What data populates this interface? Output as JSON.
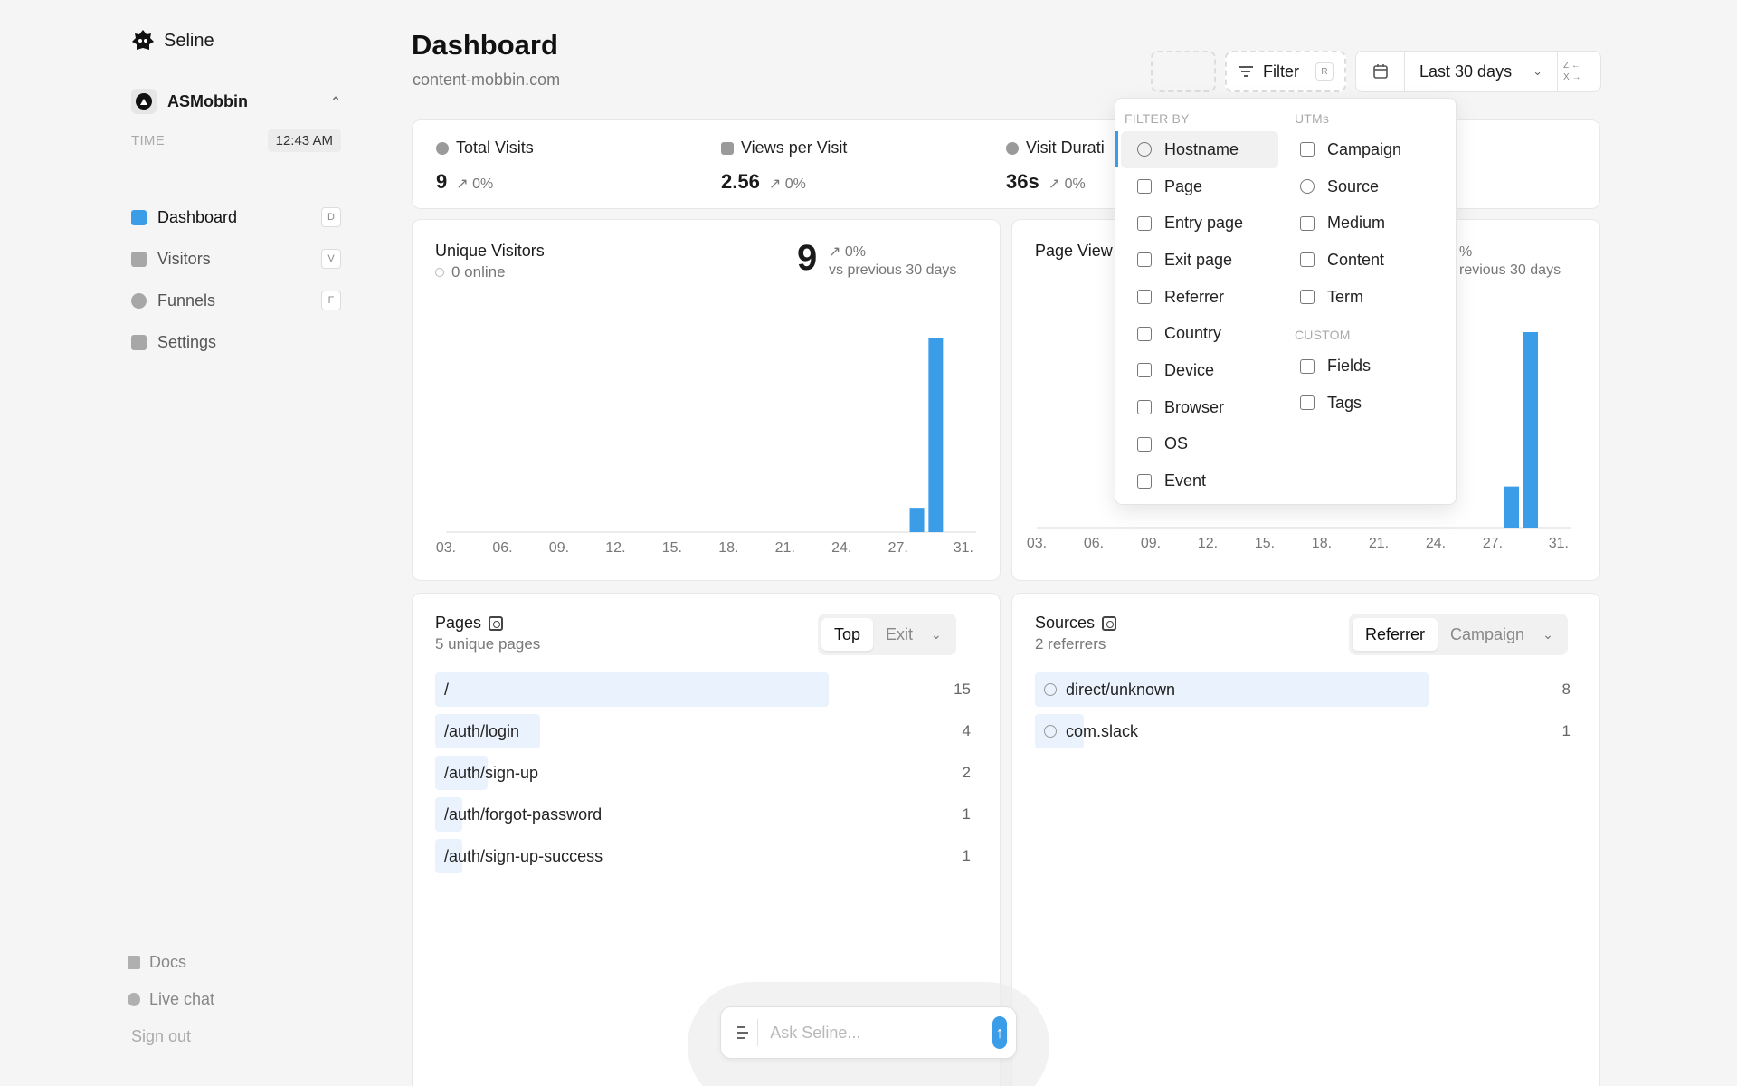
{
  "brand": {
    "name": "Seline"
  },
  "workspace": {
    "name": "ASMobbin",
    "time_label": "TIME",
    "time": "12:43 AM"
  },
  "nav": [
    {
      "label": "Dashboard",
      "key": "D",
      "active": true
    },
    {
      "label": "Visitors",
      "key": "V",
      "active": false
    },
    {
      "label": "Funnels",
      "key": "F",
      "active": false
    },
    {
      "label": "Settings",
      "key": "",
      "active": false
    }
  ],
  "footer": {
    "docs": "Docs",
    "live_chat": "Live chat",
    "sign_out": "Sign out"
  },
  "header": {
    "title": "Dashboard",
    "domain": "content-mobbin.com",
    "filter_label": "Filter",
    "filter_key": "R",
    "date_range": "Last 30 days",
    "zx_top": "Z",
    "zx_bottom": "X"
  },
  "stats": [
    {
      "label": "Total Visits",
      "value": "9",
      "change": "0%"
    },
    {
      "label": "Views per Visit",
      "value": "2.56",
      "change": "0%"
    },
    {
      "label": "Visit Durati",
      "value": "36s",
      "change": "0%"
    }
  ],
  "unique_visitors": {
    "title": "Unique Visitors",
    "online": "0 online",
    "value": "9",
    "change": "0%",
    "compare": "vs previous 30 days"
  },
  "page_views": {
    "title": "Page View",
    "change": "%",
    "compare": "revious 30 days"
  },
  "chart_data": [
    {
      "type": "bar",
      "title": "Unique Visitors",
      "x_ticks": [
        "03.",
        "06.",
        "09.",
        "12.",
        "15.",
        "18.",
        "21.",
        "24.",
        "27.",
        "31."
      ],
      "series": [
        {
          "name": "Unique Visitors",
          "bars": [
            {
              "day": 28,
              "value": 1
            },
            {
              "day": 29,
              "value": 8
            }
          ]
        }
      ],
      "ylim": [
        0,
        8
      ]
    },
    {
      "type": "bar",
      "title": "Page View",
      "x_ticks": [
        "03.",
        "06.",
        "09.",
        "12.",
        "15.",
        "18.",
        "21.",
        "24.",
        "27.",
        "31."
      ],
      "series": [
        {
          "name": "Page View",
          "bars": [
            {
              "day": 28,
              "value": 4.2
            },
            {
              "day": 29,
              "value": 20
            }
          ]
        }
      ],
      "ylim": [
        0,
        20
      ]
    }
  ],
  "pages": {
    "title": "Pages",
    "subtitle": "5 unique pages",
    "tabs": [
      "Top",
      "Exit"
    ],
    "active_tab": "Top",
    "rows": [
      {
        "label": "/",
        "count": 15
      },
      {
        "label": "/auth/login",
        "count": 4
      },
      {
        "label": "/auth/sign-up",
        "count": 2
      },
      {
        "label": "/auth/forgot-password",
        "count": 1
      },
      {
        "label": "/auth/sign-up-success",
        "count": 1
      }
    ]
  },
  "sources": {
    "title": "Sources",
    "subtitle": "2 referrers",
    "tabs": [
      "Referrer",
      "Campaign"
    ],
    "active_tab": "Referrer",
    "rows": [
      {
        "label": "direct/unknown",
        "count": 8
      },
      {
        "label": "com.slack",
        "count": 1
      }
    ]
  },
  "filter_menu": {
    "filter_by_label": "FILTER BY",
    "filter_by": [
      "Hostname",
      "Page",
      "Entry page",
      "Exit page",
      "Referrer",
      "Country",
      "Device",
      "Browser",
      "OS",
      "Event"
    ],
    "selected": "Hostname",
    "utms_label": "UTMs",
    "utms": [
      "Campaign",
      "Source",
      "Medium",
      "Content",
      "Term"
    ],
    "custom_label": "CUSTOM",
    "custom": [
      "Fields",
      "Tags"
    ]
  },
  "ask": {
    "placeholder": "Ask Seline..."
  },
  "colors": {
    "accent": "#3b9ce8",
    "row_bar": "#eaf3fd"
  }
}
